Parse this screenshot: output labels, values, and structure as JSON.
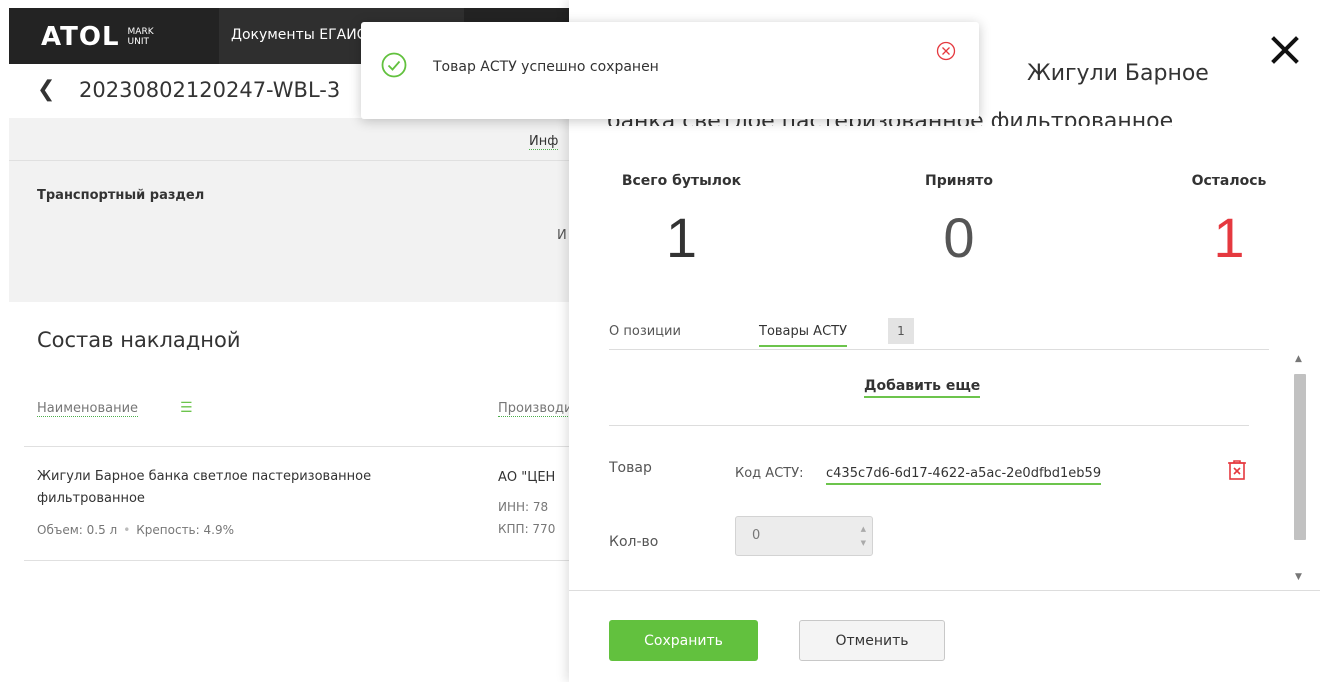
{
  "header": {
    "logo_main": "ATOL",
    "logo_sub1": "MARK",
    "logo_sub2": "UNIT",
    "nav_active": "Документы ЕГАИС"
  },
  "document": {
    "number": "20230802120247-WBL-3"
  },
  "info_area": {
    "tab_label": "Инф",
    "transport_label": "Транспортный раздел",
    "grey_letter": "И"
  },
  "composition": {
    "title": "Состав накладной",
    "col_name": "Наименование",
    "col_producer": "Производитель",
    "row": {
      "title": "Жигули Барное банка светлое пастеризованное фильтрованное",
      "volume": "Объем: 0.5 л",
      "strength": "Крепость: 4.9%",
      "producer": "АО \"ЦЕН",
      "inn": "ИНН: 78",
      "kpp": "КПП: 770"
    }
  },
  "panel": {
    "title": "Жигули Барное банка светлое пастеризованное фильтрованное",
    "stats": {
      "total_label": "Всего бутылок",
      "total_value": "1",
      "accepted_label": "Принято",
      "accepted_value": "0",
      "left_label": "Осталось",
      "left_value": "1"
    },
    "tabs": {
      "about": "О позиции",
      "goods": "Товары АСТУ",
      "goods_count": "1"
    },
    "add_more": "Добавить еще",
    "item": {
      "goods_label": "Товар",
      "code_label": "Код АСТУ:",
      "code_value": "c435c7d6-6d17-4622-a5ac-2e0dfbd1eb59",
      "qty_label": "Кол-во",
      "qty_value": "0"
    },
    "buttons": {
      "save": "Сохранить",
      "cancel": "Отменить"
    }
  },
  "toast": {
    "message": "Товар АСТУ успешно сохранен"
  },
  "colors": {
    "accent_green": "#62c13e",
    "alert_red": "#e5393f",
    "topbar": "#232323"
  }
}
